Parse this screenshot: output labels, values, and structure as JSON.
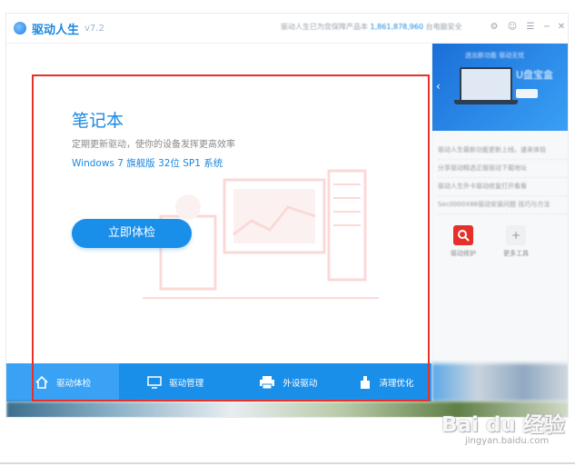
{
  "app": {
    "name": "驱动人生",
    "version": "v7.2",
    "title_notice_prefix": "驱动人生已为您保障产品本",
    "title_notice_highlight": "1,861,878,960",
    "title_notice_suffix": "台电脑安全"
  },
  "main": {
    "device_title": "笔记本",
    "subtitle": "定期更新驱动，使你的设备发挥更高效率",
    "os_info": "Windows 7 旗舰版  32位 SP1 系统",
    "check_button_label": "立即体检"
  },
  "right_panel": {
    "ad_top_text": "送出新功能 驱动无忧",
    "ad_text": "U盘宝盒",
    "news": [
      "驱动人生最新功能更新上线，速来体验",
      "分享驱动精选正版驱动下载地址",
      "驱动人生外卡驱动修复打开看看",
      "Sec0000X86驱动安装问题 技巧与方法"
    ],
    "tools": [
      {
        "label": "驱动修护",
        "icon": "repair-tool-icon"
      },
      {
        "label": "更多工具",
        "icon": "more-tools-icon"
      }
    ]
  },
  "bottom_nav": [
    {
      "label": "驱动体检",
      "icon": "home-icon",
      "active": true
    },
    {
      "label": "驱动管理",
      "icon": "monitor-icon",
      "active": false
    },
    {
      "label": "外设驱动",
      "icon": "printer-icon",
      "active": false
    },
    {
      "label": "清理优化",
      "icon": "broom-icon",
      "active": false
    }
  ],
  "watermark": {
    "main": "Bai du 经验",
    "sub": "jingyan.baidu.com"
  },
  "colors": {
    "brand_blue": "#1a8fea",
    "highlight_red": "#e5312a"
  }
}
